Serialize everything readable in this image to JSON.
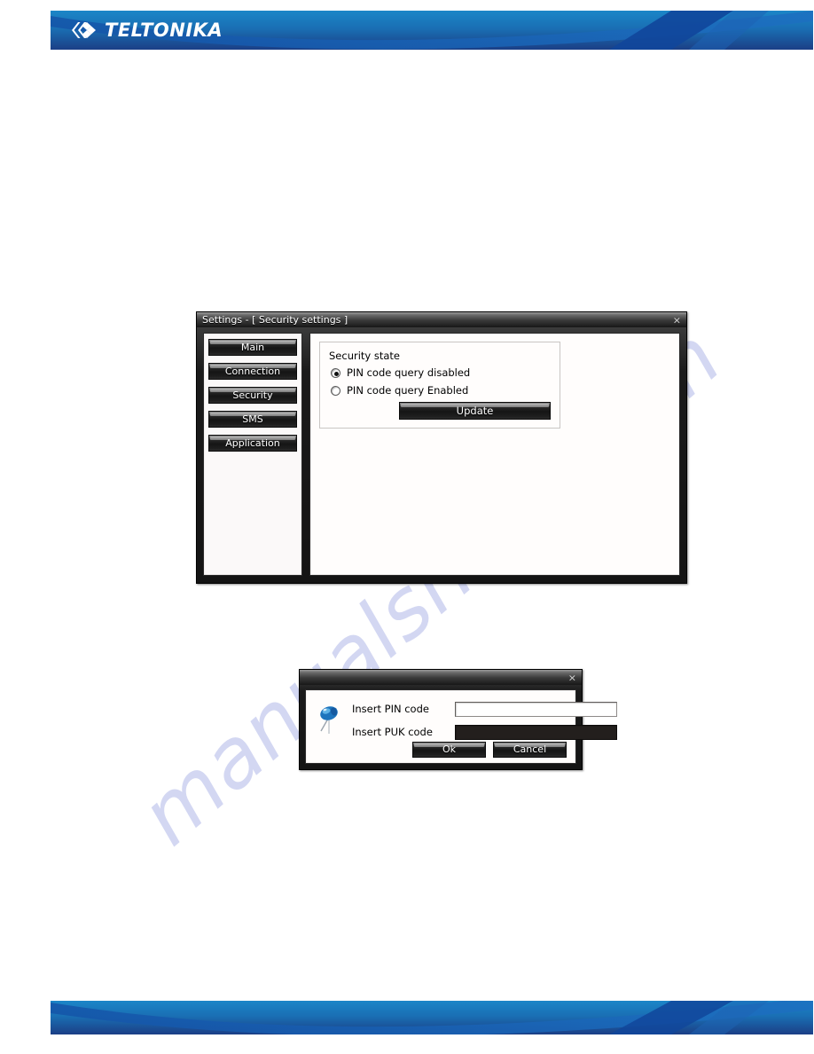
{
  "brand": {
    "logo_text": "TELTONIKA",
    "logo_icon": "chevrons-icon",
    "banner_color_light": "#1b86c8",
    "banner_color_dark": "#1b3f86",
    "banner_swoosh_color": "#1454a8"
  },
  "watermark": {
    "text": "manualshive.com",
    "color": "#96a0e1"
  },
  "settings_window": {
    "title": "Settings - [ Security settings ]",
    "close_label": "×",
    "sidebar": {
      "items": [
        {
          "label": "Main"
        },
        {
          "label": "Connection"
        },
        {
          "label": "Security"
        },
        {
          "label": "SMS"
        },
        {
          "label": "Application"
        }
      ]
    },
    "security_group": {
      "legend": "Security state",
      "options": [
        {
          "label": "PIN code query disabled",
          "selected": true
        },
        {
          "label": "PIN code query Enabled",
          "selected": false
        }
      ],
      "update_label": "Update"
    }
  },
  "pin_dialog": {
    "title": "",
    "close_label": "×",
    "icon": "pushpin-icon",
    "fields": [
      {
        "label": "Insert PIN code",
        "value": "",
        "placeholder": "",
        "disabled": false
      },
      {
        "label": "Insert PUK code",
        "value": "",
        "placeholder": "",
        "disabled": true
      }
    ],
    "ok_label": "Ok",
    "cancel_label": "Cancel"
  }
}
